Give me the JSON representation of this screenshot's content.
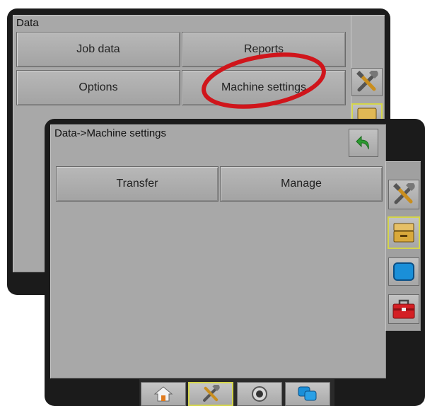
{
  "back_screen": {
    "title": "Data",
    "buttons": {
      "job_data": "Job data",
      "reports": "Reports",
      "options": "Options",
      "machine_settings": "Machine settings"
    }
  },
  "front_screen": {
    "title": "Data->Machine settings",
    "buttons": {
      "transfer": "Transfer",
      "manage": "Manage"
    }
  },
  "sidebar": {
    "items": [
      {
        "icon": "tools-icon",
        "active": false
      },
      {
        "icon": "data-drawer-icon",
        "active": true
      },
      {
        "icon": "display-icon",
        "active": false
      },
      {
        "icon": "toolbox-icon",
        "active": false
      }
    ]
  },
  "navbar": {
    "items": [
      {
        "icon": "home-icon",
        "active": false
      },
      {
        "icon": "tools-icon",
        "active": true
      },
      {
        "icon": "camera-icon",
        "active": false
      },
      {
        "icon": "screens-icon",
        "active": false
      }
    ]
  },
  "annotation": {
    "color": "#d0151b",
    "target": "Machine settings"
  }
}
